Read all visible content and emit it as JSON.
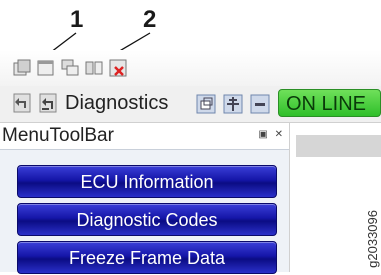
{
  "callouts": [
    "1",
    "2"
  ],
  "toolbar_row1": {
    "icons": [
      "window-restore-icon",
      "window-new-icon",
      "window-cascade-icon",
      "window-tile-icon",
      "close-windows-icon"
    ]
  },
  "toolbar_row2": {
    "icons": [
      "back-icon",
      "back-all-icon"
    ],
    "title": "Diagnostics",
    "view_icons": [
      "restore-view-icon",
      "pin-icon",
      "minimize-icon"
    ],
    "status": "ON LINE",
    "status_color": "#3cc832"
  },
  "panel": {
    "title": "MenuToolBar",
    "controls": "ᗡ ×",
    "items": [
      "ECU Information",
      "Diagnostic Codes",
      "Freeze Frame Data"
    ],
    "button_color": "#1516a8"
  },
  "figure_id": "g2033096"
}
